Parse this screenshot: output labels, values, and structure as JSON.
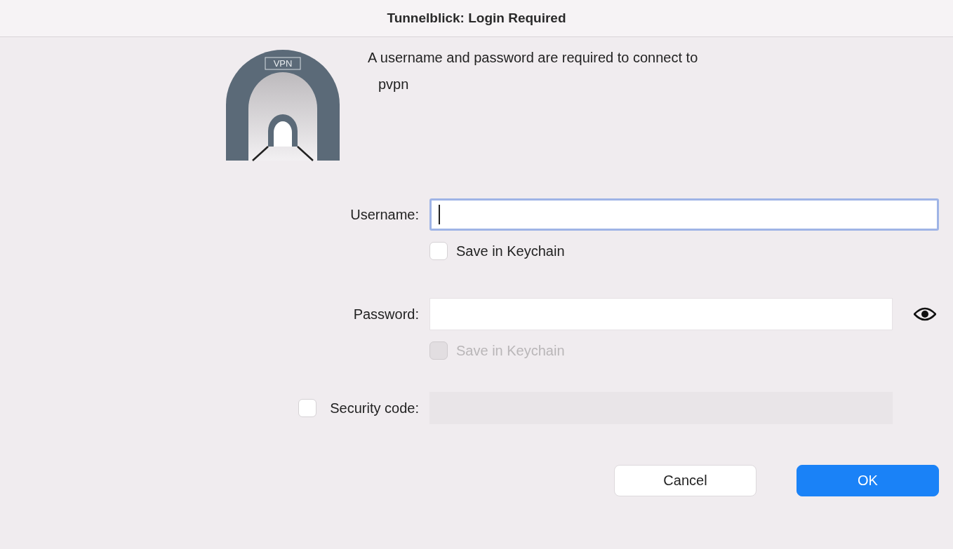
{
  "window": {
    "title": "Tunnelblick: Login Required"
  },
  "icon_label": "VPN",
  "message": [
    "A username and password are required to connect to",
    "pvpn"
  ],
  "fields": [
    {
      "kind": "text",
      "label": "Username:",
      "focused": true,
      "disabled": false,
      "save": {
        "label": "Save in Keychain",
        "checked": false,
        "disabled": false
      }
    },
    {
      "kind": "password",
      "label": "Password:",
      "focused": false,
      "disabled": false,
      "save": {
        "label": "Save in Keychain",
        "checked": false,
        "disabled": true
      }
    },
    {
      "kind": "code",
      "label": "Security code:",
      "focused": false,
      "disabled": true,
      "enable_checked": false
    }
  ],
  "buttons": [
    {
      "label": "Cancel",
      "default": false
    },
    {
      "label": "OK",
      "default": true
    }
  ]
}
